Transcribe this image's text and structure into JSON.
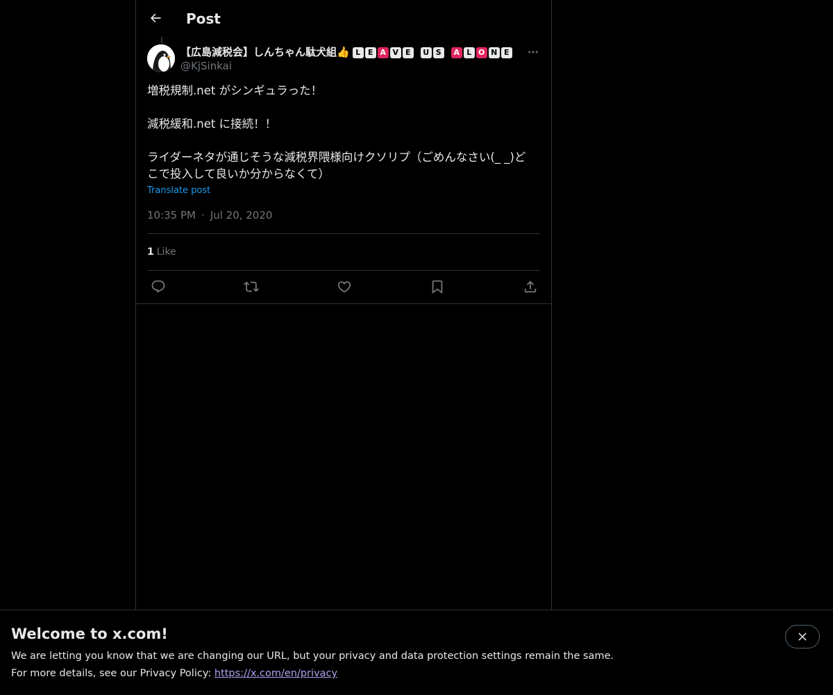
{
  "header": {
    "title": "Post"
  },
  "author": {
    "name": "【広島減税会】しんちゃん駄犬組",
    "emoji": "👍",
    "badges": [
      {
        "char": "L",
        "color": "white"
      },
      {
        "char": "E",
        "color": "white"
      },
      {
        "char": "A",
        "color": "red"
      },
      {
        "char": "V",
        "color": "white"
      },
      {
        "char": "E",
        "color": "white"
      },
      {
        "char": "U",
        "color": "white",
        "gap_before": true
      },
      {
        "char": "S",
        "color": "white"
      },
      {
        "char": "A",
        "color": "red",
        "gap_before": true
      },
      {
        "char": "L",
        "color": "white"
      },
      {
        "char": "O",
        "color": "red"
      },
      {
        "char": "N",
        "color": "white"
      },
      {
        "char": "E",
        "color": "white"
      }
    ],
    "handle": "@KjSinkai"
  },
  "post": {
    "line1": "増税規制.net がシンギュラった！",
    "line2": "減税緩和.net に接続！！",
    "line3": "ライダーネタが通じそうな減税界隈様向けクソリプ（ごめんなさい(_ _)ど\nこで投入して良いか分からなくて）",
    "translate_label": "Translate post",
    "time": "10:35 PM",
    "date": "Jul 20, 2020",
    "separator": "·"
  },
  "stats": {
    "like_count": "1",
    "like_label": "Like"
  },
  "actions": {
    "icons": [
      "reply-icon",
      "repost-icon",
      "like-icon",
      "bookmark-icon",
      "share-icon"
    ]
  },
  "banner": {
    "title": "Welcome to x.com!",
    "line1": "We are letting you know that we are changing our URL, but your privacy and data protection settings remain the same.",
    "line2_prefix": "For more details, see our Privacy Policy: ",
    "link": "https://x.com/en/privacy"
  },
  "colors": {
    "background": "#000000",
    "text": "#e7e9ea",
    "muted": "#71767b",
    "accent": "#1d9bf0",
    "link_visited": "#b3a0f0",
    "border": "#2f3336"
  }
}
